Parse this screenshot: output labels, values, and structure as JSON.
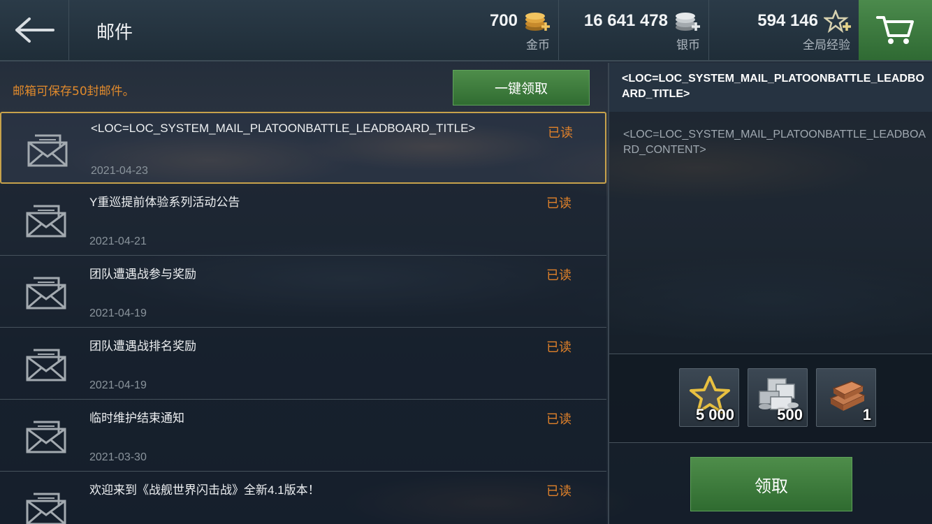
{
  "header": {
    "title": "邮件",
    "currencies": [
      {
        "value": "700",
        "label": "金币",
        "icon": "gold-coins-plus-icon",
        "color": "#d9a441"
      },
      {
        "value": "16 641 478",
        "label": "银币",
        "icon": "silver-coins-plus-icon",
        "color": "#c8ccd0"
      },
      {
        "value": "594 146",
        "label": "全局经验",
        "icon": "star-plus-icon",
        "color": "#d8d2b0"
      }
    ]
  },
  "mailbox": {
    "capacity_note": "邮箱可保存50封邮件。",
    "claim_all_label": "一键领取",
    "mails": [
      {
        "title": "<LOC=LOC_SYSTEM_MAIL_PLATOONBATTLE_LEADBOARD_TITLE>",
        "date": "2021-04-23",
        "status": "已读"
      },
      {
        "title": "Y重巡提前体验系列活动公告",
        "date": "2021-04-21",
        "status": "已读"
      },
      {
        "title": "团队遭遇战参与奖励",
        "date": "2021-04-19",
        "status": "已读"
      },
      {
        "title": "团队遭遇战排名奖励",
        "date": "2021-04-19",
        "status": "已读"
      },
      {
        "title": "临时维护结束通知",
        "date": "2021-03-30",
        "status": "已读"
      },
      {
        "title": "欢迎来到《战舰世界闪击战》全新4.1版本！",
        "date": "",
        "status": "已读"
      }
    ]
  },
  "detail": {
    "title": "<LOC=LOC_SYSTEM_MAIL_PLATOONBATTLE_LEADBOARD_TITLE>",
    "content": "<LOC=LOC_SYSTEM_MAIL_PLATOONBATTLE_LEADBOARD_CONTENT>",
    "rewards": [
      {
        "amount": "5 000",
        "icon": "star-experience-icon"
      },
      {
        "amount": "500",
        "icon": "silver-cash-stack-icon"
      },
      {
        "amount": "1",
        "icon": "copper-ingots-icon"
      }
    ],
    "claim_label": "领取"
  },
  "colors": {
    "accent_green": "#3f7d3f",
    "status_orange": "#e0812a",
    "selected_border": "#c7a24b"
  }
}
